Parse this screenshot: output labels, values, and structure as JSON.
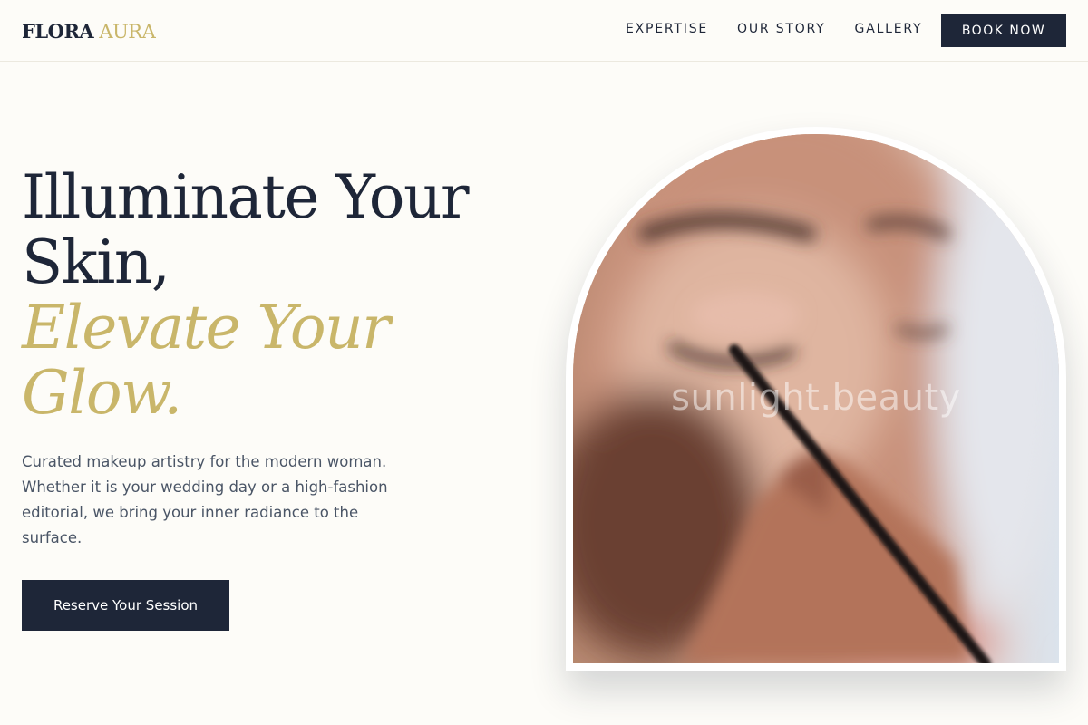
{
  "brand": {
    "name_part1": "FLORA",
    "name_part2": "AURA"
  },
  "nav": {
    "links": [
      "EXPERTISE",
      "OUR STORY",
      "GALLERY"
    ],
    "book_button": "BOOK NOW"
  },
  "hero": {
    "title_line1": "Illuminate Your",
    "title_line2": "Skin,",
    "title_accent_line1": "Elevate Your",
    "title_accent_line2": "Glow.",
    "description": "Curated makeup artistry for the modern woman. Whether it is your wedding day or a high-fashion editorial, we bring your inner radiance to the surface.",
    "cta_label": "Reserve Your Session"
  },
  "image": {
    "watermark": "sunlight.beauty"
  },
  "colors": {
    "navy": "#1e2638",
    "gold": "#c9b66a",
    "cream": "#fdfcf8",
    "body_text": "#4a5566"
  }
}
